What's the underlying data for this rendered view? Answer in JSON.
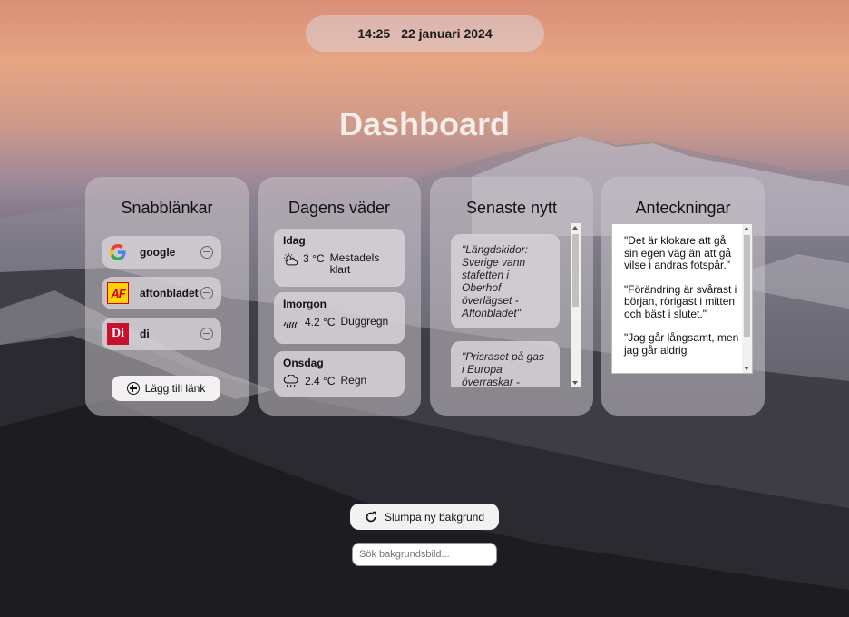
{
  "clock": {
    "time": "14:25",
    "date": "22 januari 2024"
  },
  "page_title": "Dashboard",
  "quick_links": {
    "title": "Snabblänkar",
    "items": [
      {
        "name": "google",
        "logo_text": "G"
      },
      {
        "name": "aftonbladet",
        "logo_text": "AF"
      },
      {
        "name": "di",
        "logo_text": "Di"
      }
    ],
    "add_label": "Lägg till länk"
  },
  "weather": {
    "title": "Dagens väder",
    "days": [
      {
        "day": "Idag",
        "temp": "3 °C",
        "desc": "Mestadels klart",
        "icon": "partly-cloudy-icon"
      },
      {
        "day": "Imorgon",
        "temp": "4.2 °C",
        "desc": "Duggregn",
        "icon": "drizzle-icon"
      },
      {
        "day": "Onsdag",
        "temp": "2.4 °C",
        "desc": "Regn",
        "icon": "rain-icon"
      }
    ]
  },
  "news": {
    "title": "Senaste nytt",
    "items": [
      {
        "text": "\"Längdskidor: Sverige vann stafetten i Oberhof överlägset - Aftonbladet\""
      },
      {
        "text": "\"Prisraset på gas i Europa överraskar -"
      }
    ]
  },
  "notes": {
    "title": "Anteckningar",
    "paragraphs": [
      "\"Det är klokare att gå sin egen väg än att gå vilse i andras fotspår.\"",
      "\"Förändring är svårast i början, rörigast i mitten och bäst i slutet.\"",
      "\"Jag går långsamt, men jag går aldrig"
    ]
  },
  "background": {
    "random_label": "Slumpa ny bakgrund",
    "search_placeholder": "Sök bakgrundsbild..."
  },
  "colors": {
    "google_blue": "#4285F4",
    "google_red": "#EA4335",
    "google_yellow": "#FBBC05",
    "google_green": "#34A853",
    "aftonbladet_yellow": "#ffd400",
    "aftonbladet_red": "#d8000f",
    "di_red": "#c8102e"
  }
}
